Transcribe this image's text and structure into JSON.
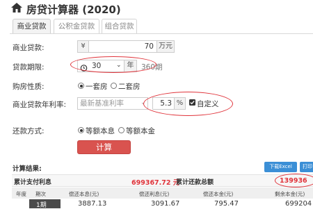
{
  "header": {
    "title": "房贷计算器 (2020)",
    "home_icon": "home-icon"
  },
  "tabs": [
    {
      "label": "商业贷款",
      "active": true
    },
    {
      "label": "公积金贷款",
      "active": false
    },
    {
      "label": "组合贷款",
      "active": false
    }
  ],
  "form": {
    "loan_amount": {
      "label": "商业贷款:",
      "prefix": "¥",
      "value": "70",
      "unit": "万元"
    },
    "loan_term": {
      "label": "贷款期限:",
      "value": "30",
      "unit": "年",
      "periods": "360期"
    },
    "house_type": {
      "label": "购房性质:",
      "options": [
        "一套房",
        "二套房"
      ],
      "selected": "一套房"
    },
    "rate": {
      "label": "商业贷款年利率:",
      "select_value": "最新基准利率",
      "value": "5.3",
      "unit": "%",
      "custom_label": "自定义",
      "custom_checked": true
    },
    "repay": {
      "label": "还款方式:",
      "options": [
        "等额本息",
        "等额本金"
      ],
      "selected": "等额本息"
    },
    "calc_button": "计算"
  },
  "results": {
    "title": "计算结果:",
    "download_button": "下载Excel",
    "print_button": "打印",
    "total_interest_label": "累计支付利息",
    "total_interest_value": "699367.72 元",
    "total_repay_label": "累计还款总额",
    "total_repay_value": "139936",
    "columns": [
      "年度",
      "期次",
      "偿还本息(元)",
      "偿还利息(元)",
      "偿还本金(元)",
      "剩余本金(元)"
    ],
    "rows": [
      {
        "year": "",
        "period": "1期",
        "payment": "3887.13",
        "interest": "3091.67",
        "principal": "795.47",
        "remaining": "699204"
      }
    ]
  },
  "colors": {
    "accent_red": "#d9534f",
    "highlight_red": "#e0333a",
    "blue": "#3b8fd6",
    "period_bg": "#4a4a4a"
  }
}
